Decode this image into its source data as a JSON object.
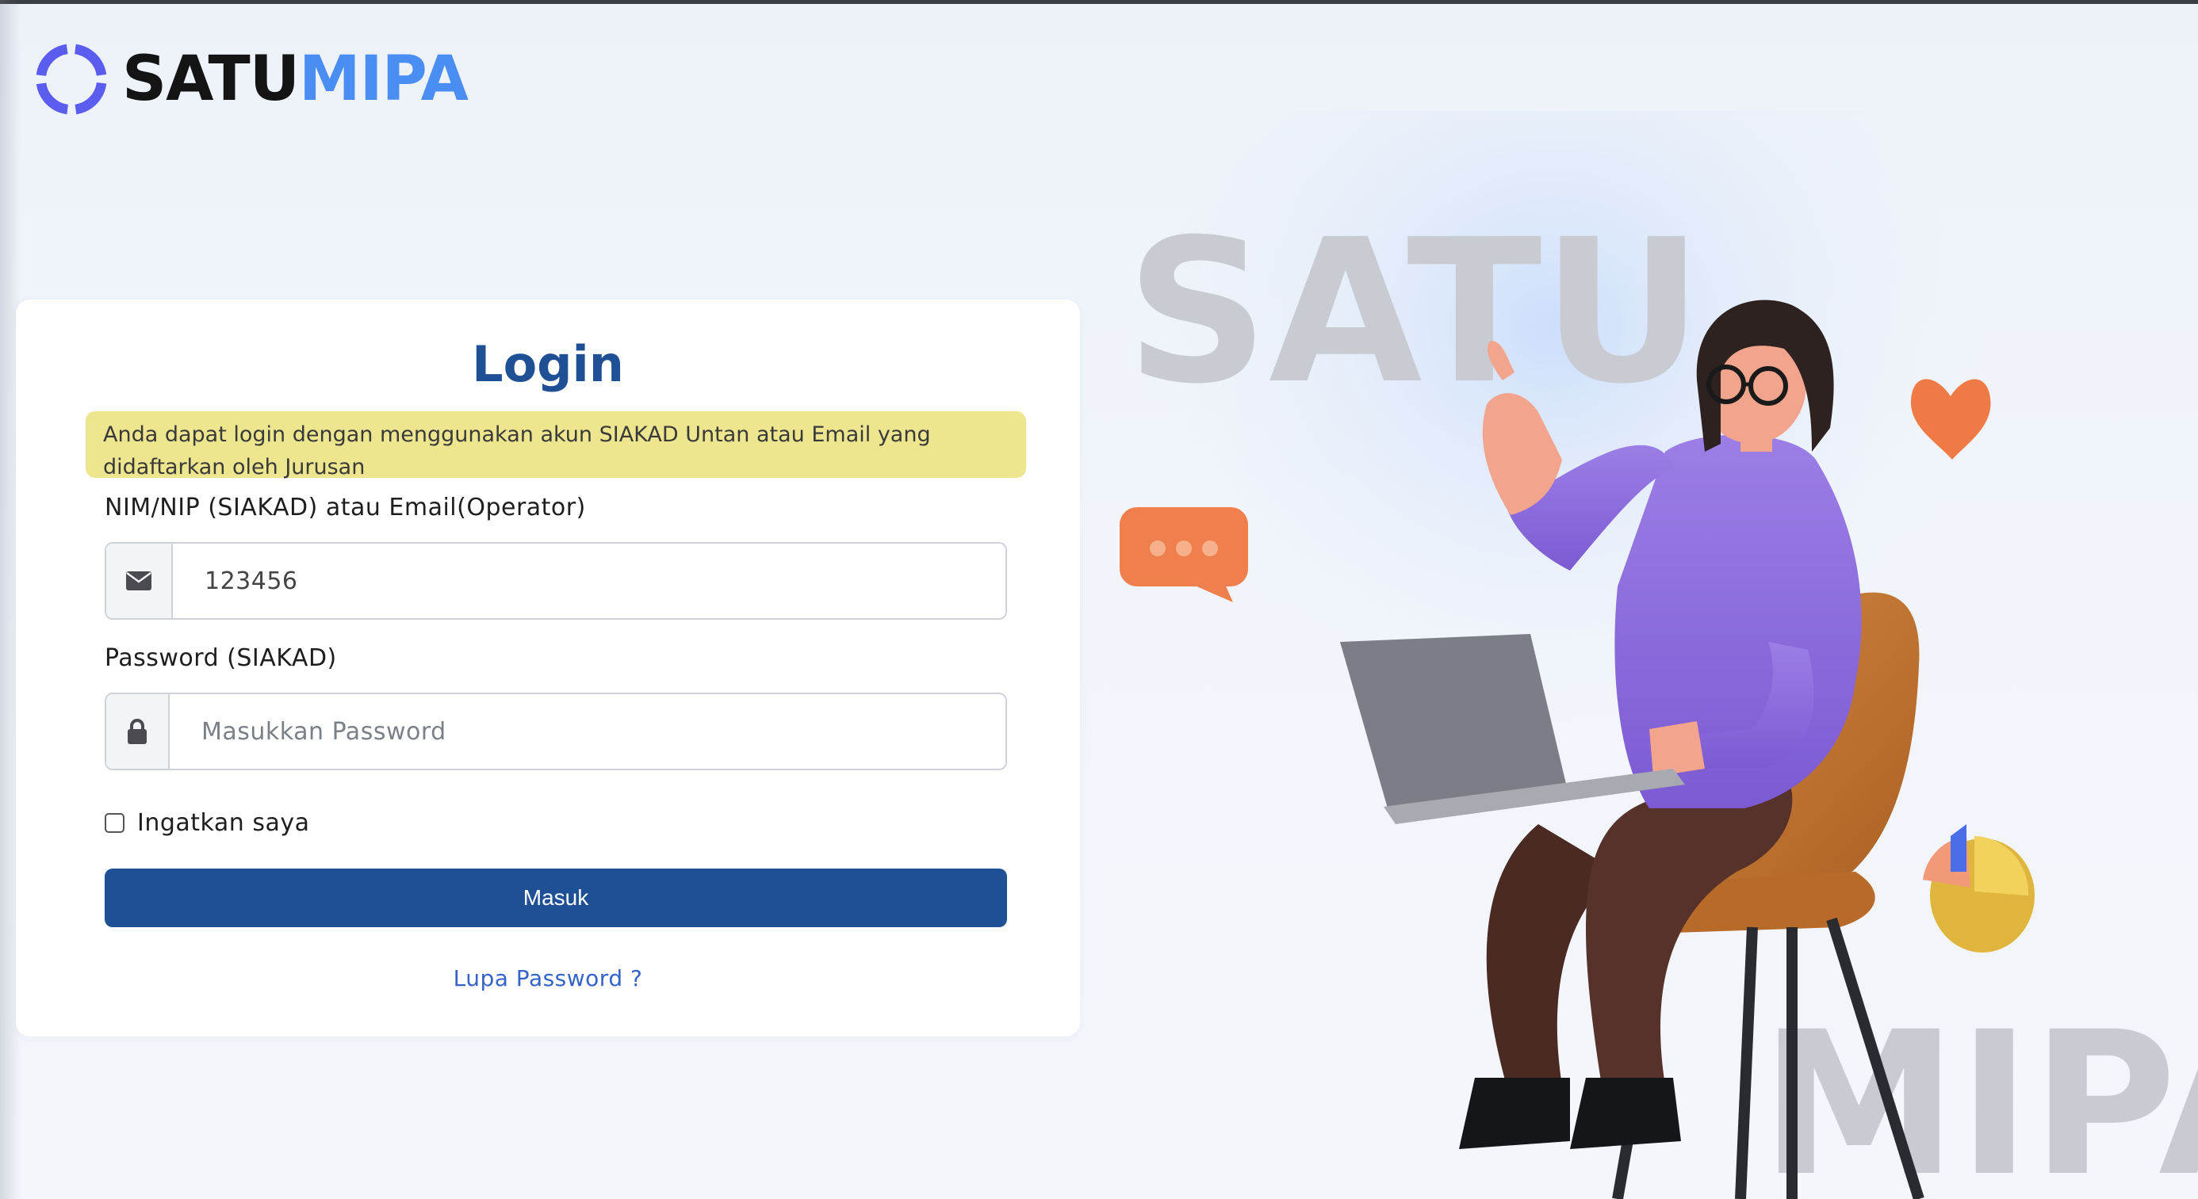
{
  "brand": {
    "part1": "SATU",
    "part2": "MIPA"
  },
  "login": {
    "title": "Login",
    "notice_line1": "Anda dapat login dengan menggunakan akun SIAKAD Untan atau Email yang",
    "notice_line2": "didaftarkan oleh Jurusan",
    "username_label": "NIM/NIP (SIAKAD) atau Email(Operator)",
    "username_value": "123456",
    "username_icon": "envelope-icon",
    "password_label": "Password (SIAKAD)",
    "password_placeholder": "Masukkan Password",
    "password_icon": "lock-icon",
    "remember_label": "Ingatkan saya",
    "remember_checked": false,
    "submit_label": "Masuk",
    "forgot_label": "Lupa Password ?"
  },
  "illustration": {
    "watermark_top": "SATU",
    "watermark_bottom": "MIPA",
    "chat_icon": "chat-bubble-icon",
    "heart_icon": "heart-icon",
    "chart_icon": "pie-chart-icon"
  },
  "colors": {
    "primary": "#1f4f94",
    "brand_accent": "#4b8ef3",
    "logo_ring": "#5b5cf0",
    "notice_bg": "#ede68f",
    "link": "#3563c8"
  }
}
